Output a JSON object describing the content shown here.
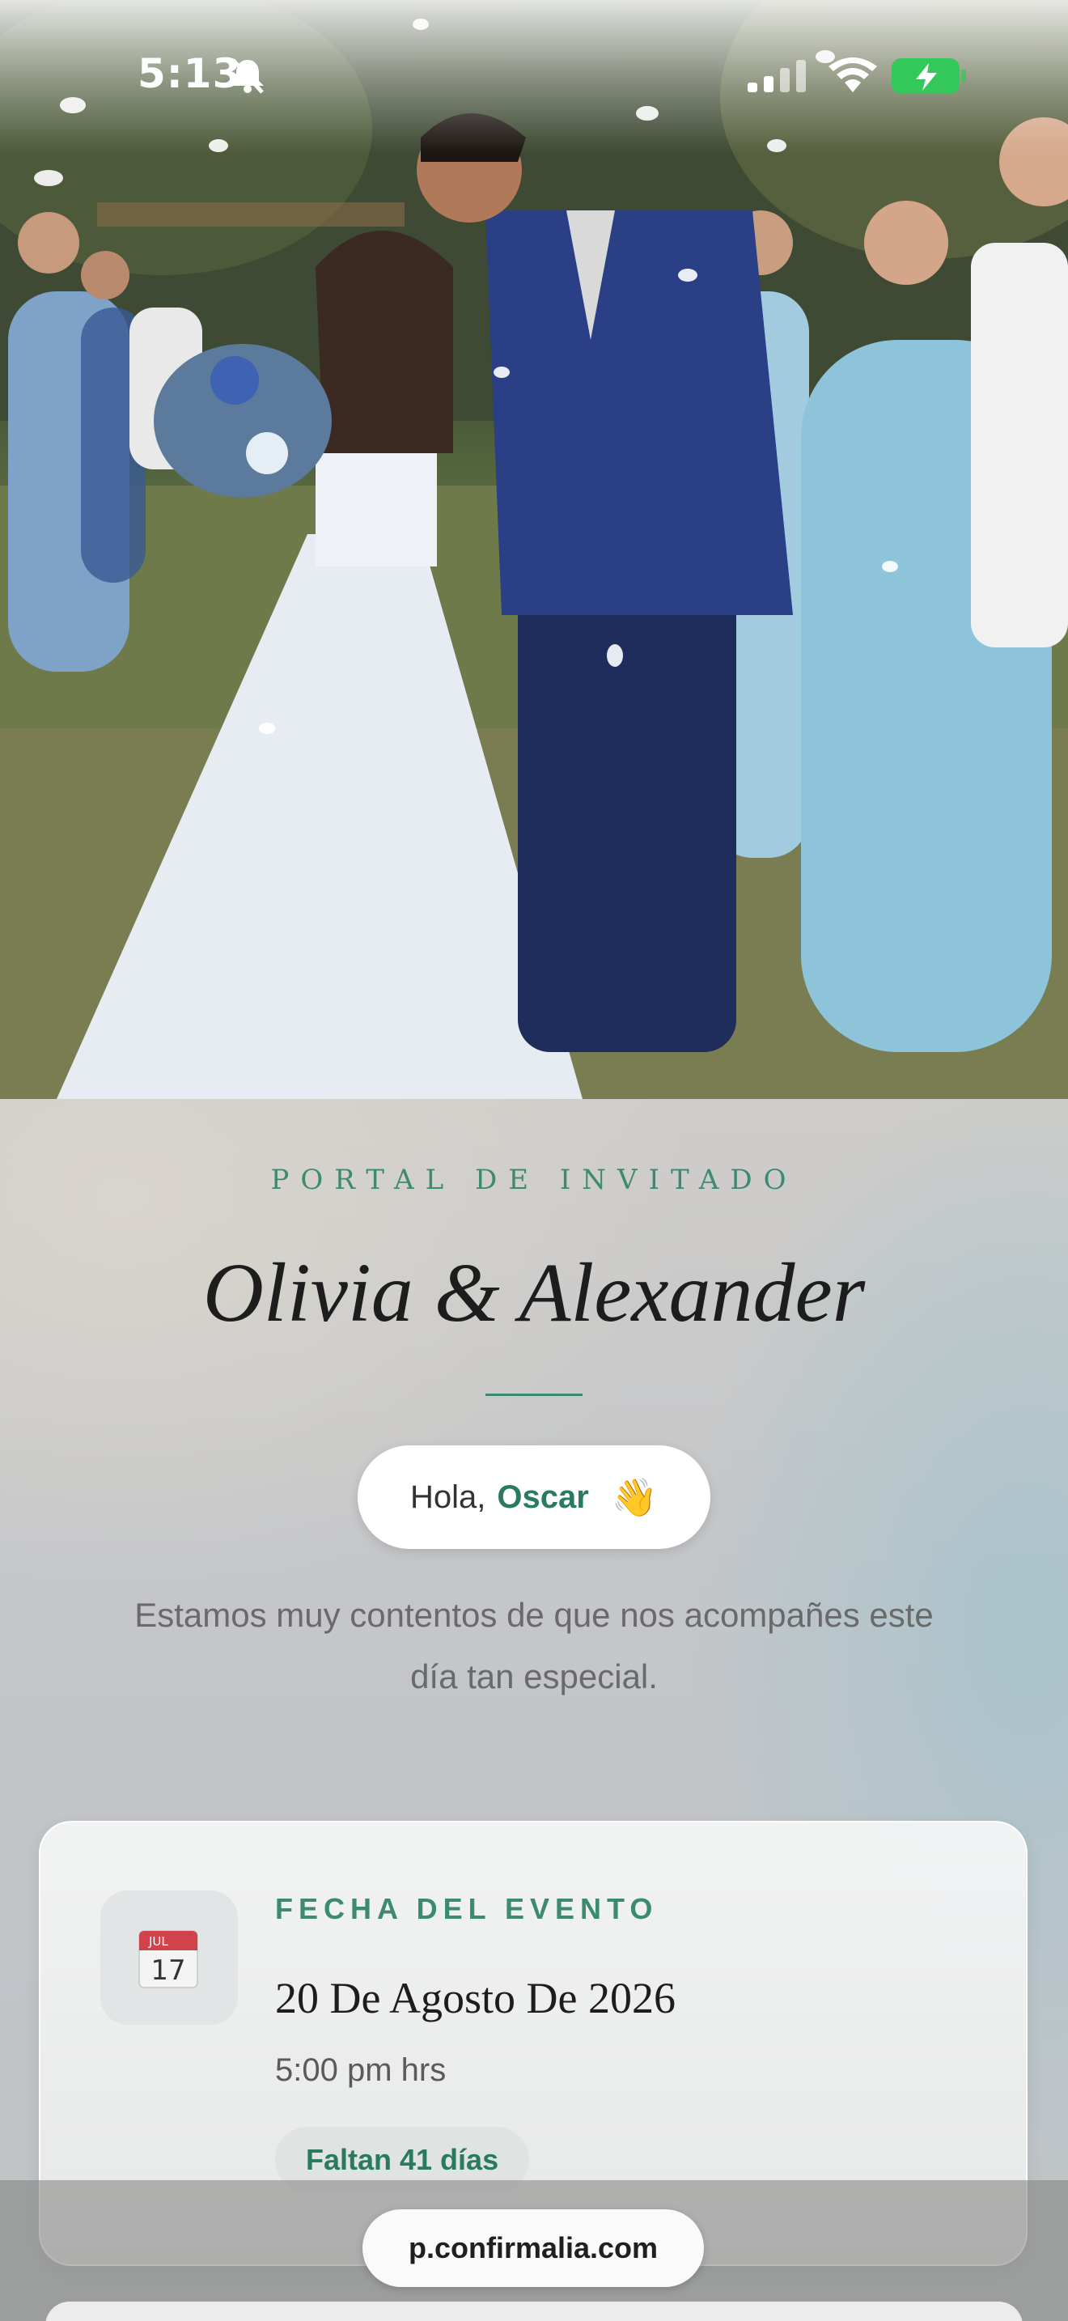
{
  "status_bar": {
    "time": "5:13"
  },
  "hero": {
    "alt_icon": "wedding-photo"
  },
  "portal": {
    "label": "PORTAL DE INVITADO",
    "couple": "Olivia & Alexander",
    "greeting_prefix": "Hola,",
    "guest_name": "Oscar",
    "wave": "👋",
    "welcome": "Estamos muy contentos de que nos acompañes este día tan especial."
  },
  "event": {
    "label": "FECHA DEL EVENTO",
    "calendar_month": "JUL",
    "calendar_day": "17",
    "date": "20 De Agosto De 2026",
    "time": "5:00 pm hrs",
    "countdown": "Faltan 41 días"
  },
  "browser": {
    "url": "p.confirmalia.com"
  },
  "colors": {
    "accent": "#3d8a73",
    "accent_dark": "#2a7a62",
    "battery": "#34c759"
  }
}
